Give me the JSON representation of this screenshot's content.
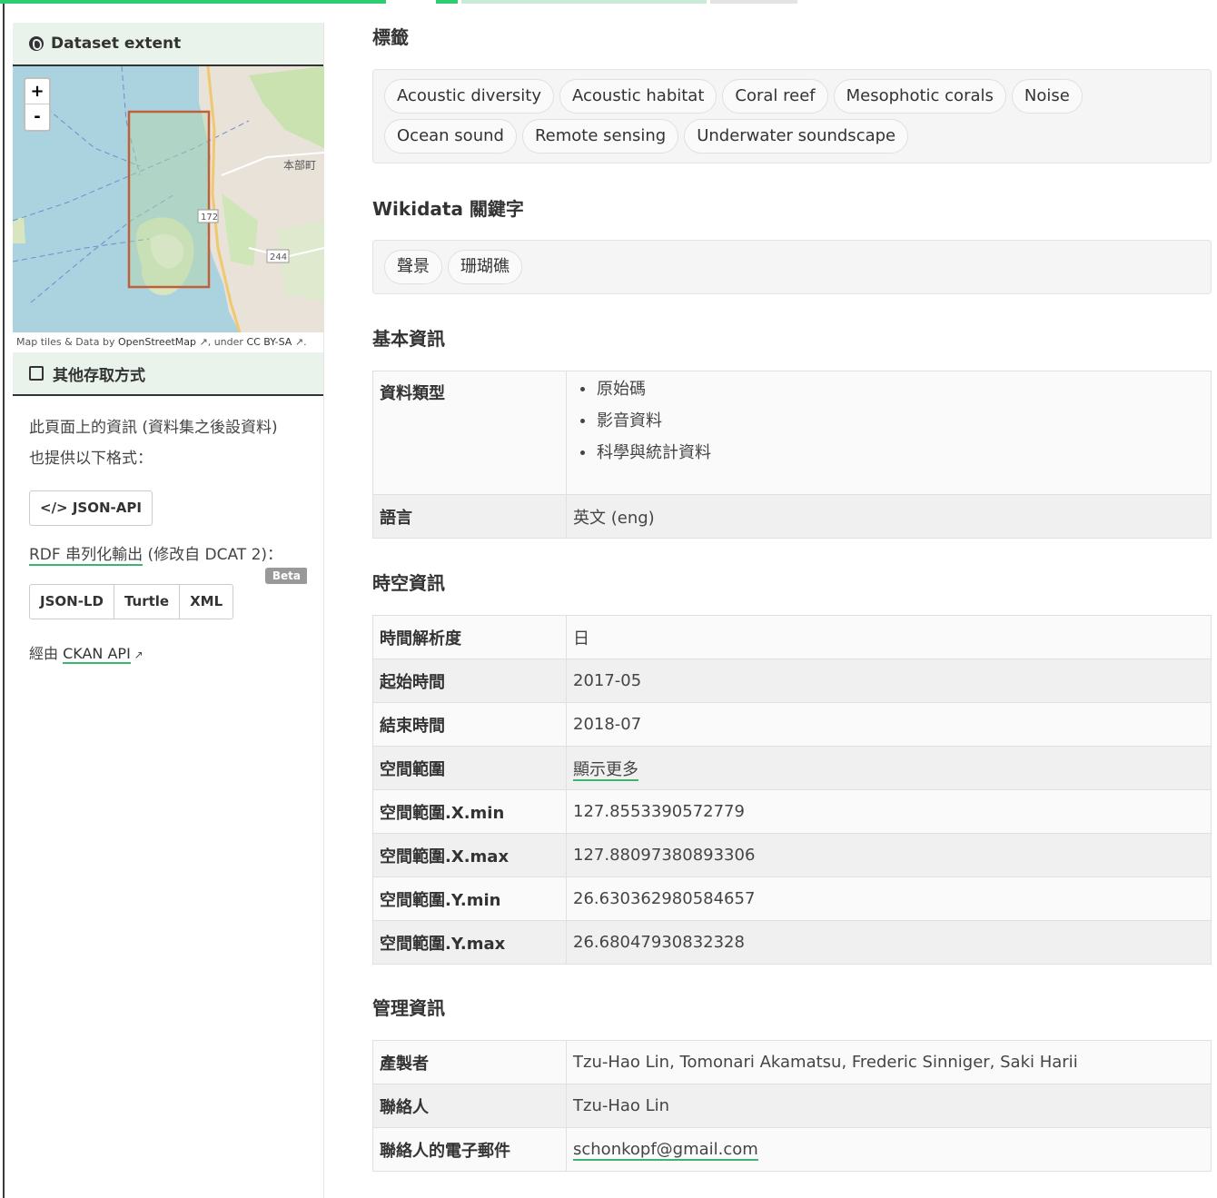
{
  "sidebar": {
    "extent_title": "Dataset extent",
    "map": {
      "zoom_in": "+",
      "zoom_out": "-",
      "label_town": "本部町",
      "label_road_1": "172",
      "label_road_2": "244",
      "attribution_prefix": "Map tiles & Data by ",
      "attribution_osm": "OpenStreetMap",
      "attribution_mid": ", under ",
      "attribution_license": "CC BY-SA",
      "attribution_end": "."
    },
    "other_access_title": "其他存取方式",
    "formats_text_1": "此頁面上的資訊 (資料集之後設資料)",
    "formats_text_2": "也提供以下格式：",
    "json_api_button": "JSON-API",
    "rdf_prefix": "RDF 串列化輸出",
    "rdf_suffix": " (修改自 DCAT 2)：",
    "beta_badge": "Beta",
    "rdf_buttons": [
      "JSON-LD",
      "Turtle",
      "XML"
    ],
    "via_prefix": "經由 ",
    "via_link": "CKAN API"
  },
  "tags": {
    "title": "標籤",
    "items": [
      "Acoustic diversity",
      "Acoustic habitat",
      "Coral reef",
      "Mesophotic corals",
      "Noise",
      "Ocean sound",
      "Remote sensing",
      "Underwater soundscape"
    ]
  },
  "wikidata": {
    "title": "Wikidata 關鍵字",
    "items": [
      "聲景",
      "珊瑚礁"
    ]
  },
  "basic": {
    "title": "基本資訊",
    "type_label": "資料類型",
    "types": [
      "原始碼",
      "影音資料",
      "科學與統計資料"
    ],
    "lang_label": "語言",
    "lang_value": "英文 (eng)"
  },
  "spatiotemporal": {
    "title": "時空資訊",
    "rows": [
      {
        "k": "時間解析度",
        "v": "日"
      },
      {
        "k": "起始時間",
        "v": "2017-05"
      },
      {
        "k": "結束時間",
        "v": "2018-07"
      },
      {
        "k": "空間範圍",
        "v": "顯示更多"
      },
      {
        "k": "空間範圍.X.min",
        "v": "127.8553390572779"
      },
      {
        "k": "空間範圍.X.max",
        "v": "127.88097380893306"
      },
      {
        "k": "空間範圍.Y.min",
        "v": "26.630362980584657"
      },
      {
        "k": "空間範圍.Y.max",
        "v": "26.68047930832328"
      }
    ]
  },
  "admin": {
    "title": "管理資訊",
    "rows": [
      {
        "k": "產製者",
        "v": "Tzu-Hao Lin, Tomonari Akamatsu, Frederic Sinniger, Saki Harii"
      },
      {
        "k": "聯絡人",
        "v": "Tzu-Hao Lin"
      },
      {
        "k": "聯絡人的電子郵件",
        "v": "schonkopf@gmail.com"
      }
    ]
  },
  "colors": {
    "accent": "#3cb371",
    "panel_bg": "#e9f3ec",
    "map_water": "#aad3df",
    "extent_box": "#c0603a"
  }
}
